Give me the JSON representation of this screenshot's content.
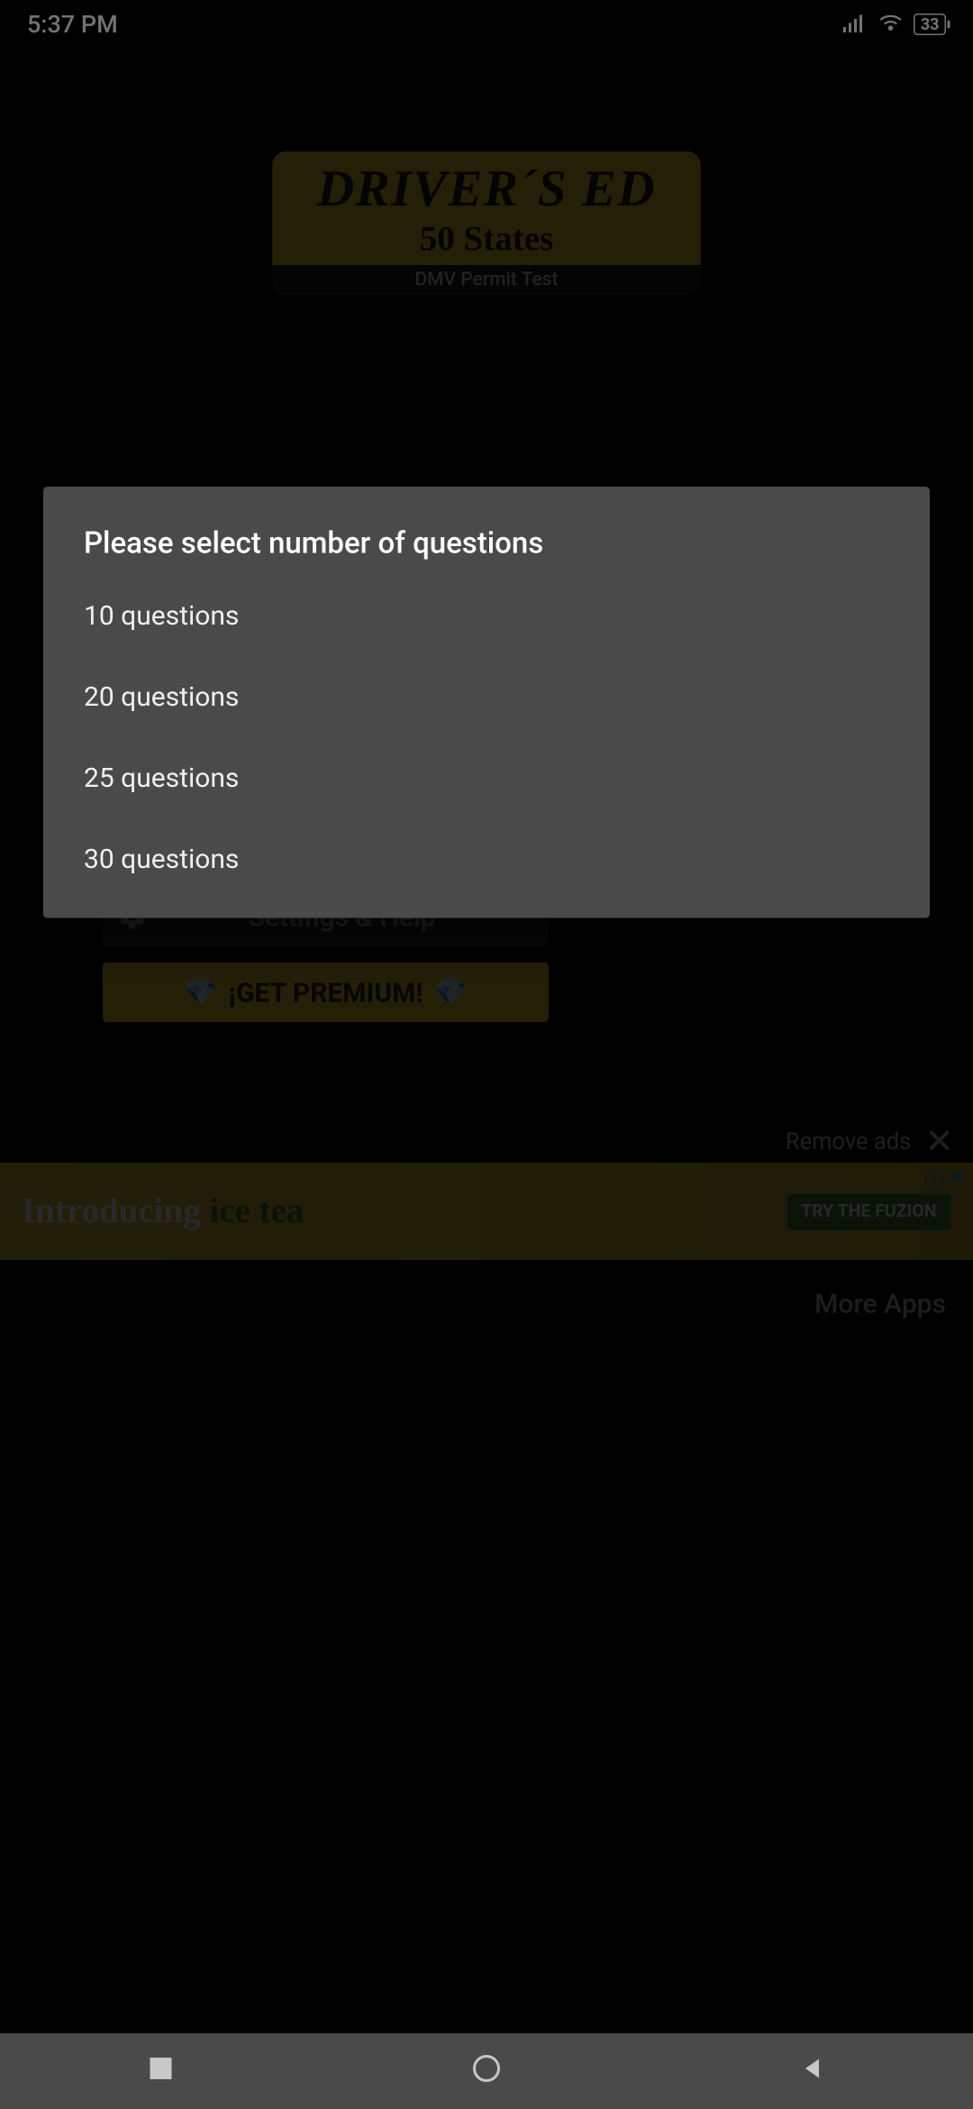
{
  "status": {
    "time": "5:37 PM",
    "battery": "33"
  },
  "logo": {
    "title": "DRIVER´S ED",
    "subtitle": "50 States",
    "tagline": "DMV Permit Test"
  },
  "buttons": {
    "settings_label": "Settings & Help",
    "premium_label": "¡GET PREMIUM!"
  },
  "remove_ads_label": "Remove ads",
  "ad": {
    "line1": "Introducing",
    "line2": "ice tea",
    "cta": "TRY THE FUZION"
  },
  "more_apps_label": "More Apps",
  "modal": {
    "title": "Please select number of questions",
    "options": [
      "10 questions",
      "20 questions",
      "25 questions",
      "30 questions"
    ]
  }
}
